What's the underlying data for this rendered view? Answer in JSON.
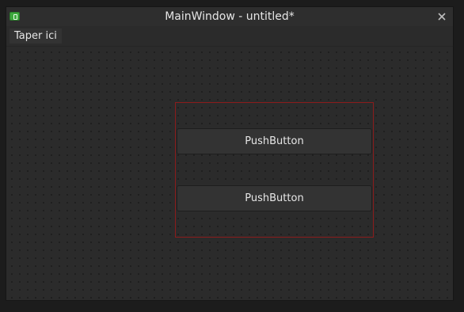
{
  "window": {
    "title": "MainWindow - untitled*"
  },
  "titlebar": {
    "app_icon": "qt-designer-icon",
    "close_icon": "close-icon"
  },
  "menubar": {
    "items": [
      {
        "label": "Taper ici"
      }
    ]
  },
  "form": {
    "buttons": [
      {
        "label": "PushButton"
      },
      {
        "label": "PushButton"
      }
    ]
  },
  "colors": {
    "window_bg": "#2b2b2b",
    "layout_border": "#8b1c1c",
    "text": "#e6e6e6"
  }
}
